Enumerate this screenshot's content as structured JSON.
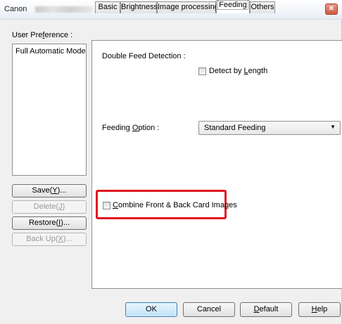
{
  "window": {
    "title": "Canon",
    "close_glyph": "✕"
  },
  "sidebar": {
    "label": "User Preference :",
    "list_items": [
      "Full Automatic Mode"
    ],
    "buttons": {
      "save": "Save(Y)...",
      "delete": "Delete(J)",
      "restore": "Restore(I)...",
      "backup": "Back Up(X)..."
    }
  },
  "tabs": [
    "Basic",
    "Brightness",
    "Image processing",
    "Feeding",
    "Others"
  ],
  "active_tab": "Feeding",
  "feeding": {
    "double_feed_label": "Double Feed Detection :",
    "detect_by_length": "Detect by Length",
    "detect_by_length_checked": false,
    "feeding_option_label": "Feeding Option :",
    "feeding_option_value": "Standard Feeding",
    "combine_label": "Combine Front & Back Card Images",
    "combine_checked": false,
    "highlight_color": "#e0151f"
  },
  "footer": {
    "ok": "OK",
    "cancel": "Cancel",
    "default": "Default",
    "help": "Help"
  }
}
